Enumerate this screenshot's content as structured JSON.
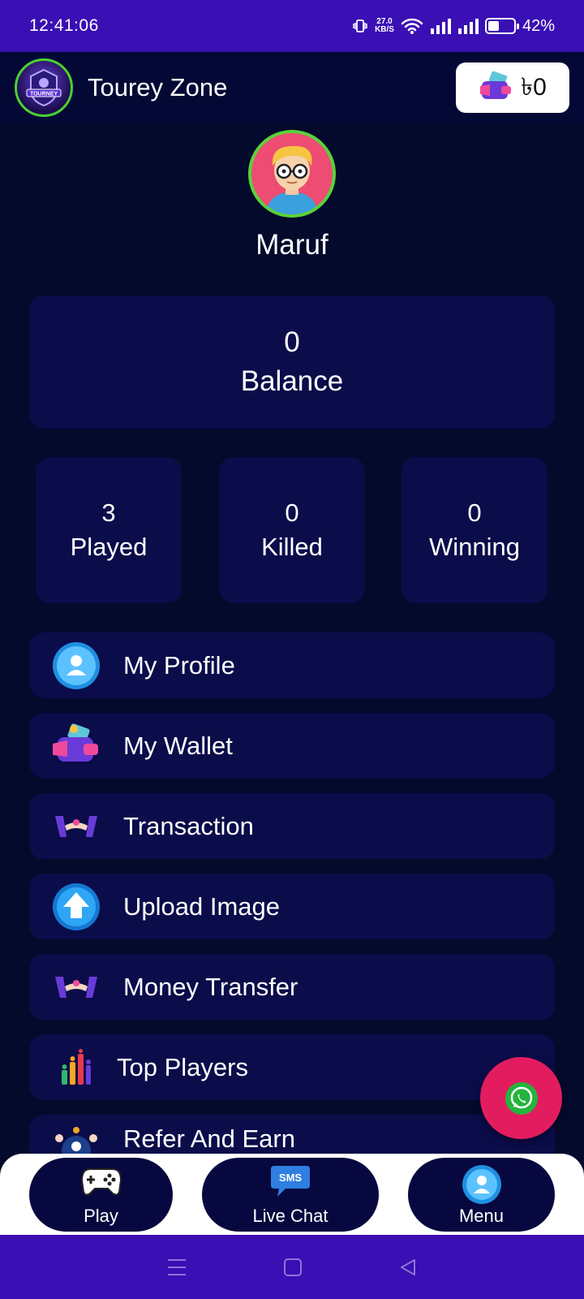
{
  "status_bar": {
    "time": "12:41:06",
    "net_speed_value": "27.0",
    "net_speed_unit": "KB/S",
    "battery_percent": "42%",
    "battery_level": 0.42
  },
  "header": {
    "logo_text": "TOURNEY",
    "title": "Tourey Zone",
    "wallet_amount": "৳0"
  },
  "profile": {
    "username": "Maruf"
  },
  "balance": {
    "value": "0",
    "label": "Balance"
  },
  "stats": [
    {
      "value": "3",
      "label": "Played"
    },
    {
      "value": "0",
      "label": "Killed"
    },
    {
      "value": "0",
      "label": "Winning"
    }
  ],
  "menu": [
    {
      "label": "My Profile",
      "icon": "profile-icon"
    },
    {
      "label": "My Wallet",
      "icon": "wallet-icon"
    },
    {
      "label": "Transaction",
      "icon": "transaction-icon"
    },
    {
      "label": "Upload Image",
      "icon": "upload-icon"
    },
    {
      "label": "Money Transfer",
      "icon": "money-transfer-icon"
    },
    {
      "label": "Top Players",
      "icon": "top-players-icon"
    },
    {
      "label": "Refer And Earn",
      "icon": "refer-icon"
    }
  ],
  "bottom_nav": {
    "play": "Play",
    "live_chat": "Live Chat",
    "sms_badge": "SMS",
    "menu": "Menu"
  },
  "colors": {
    "status_bar": "#3a0fb4",
    "background": "#030a2b",
    "card": "#0b0c4a",
    "accent_green": "#58d33a",
    "fab": "#e31c5f"
  }
}
